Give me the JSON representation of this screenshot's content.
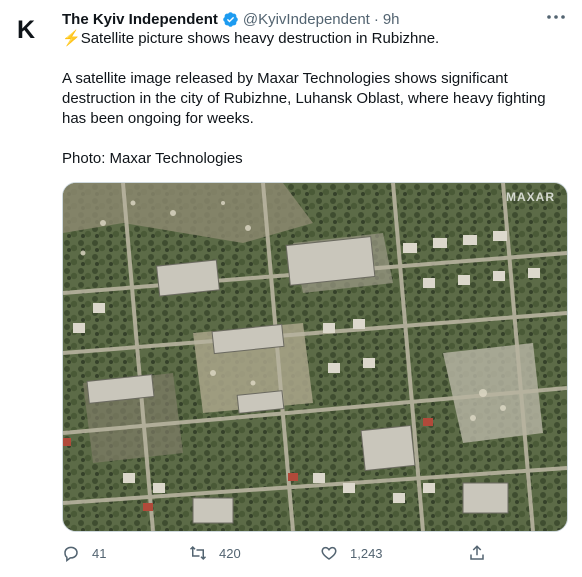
{
  "tweet": {
    "author_name": "The Kyiv Independent",
    "avatar_letter": "K",
    "handle": "@KyivIndependent",
    "separator": "·",
    "time": "9h",
    "lines": [
      "Satellite picture shows heavy destruction in Rubizhne.",
      "A satellite image released by Maxar Technologies shows significant",
      "destruction in the city of Rubizhne, Luhansk Oblast, where heavy fighting",
      "has been ongoing for weeks.",
      "Photo: Maxar Technologies"
    ],
    "bolt_emoji": "⚡",
    "media": {
      "watermark": "MAXAR"
    },
    "actions": {
      "replies": "41",
      "retweets": "420",
      "likes": "1,243"
    }
  },
  "colors": {
    "text": "#0f1419",
    "secondary": "#536471",
    "verified": "#1d9bf0",
    "border": "#cfd9de"
  }
}
